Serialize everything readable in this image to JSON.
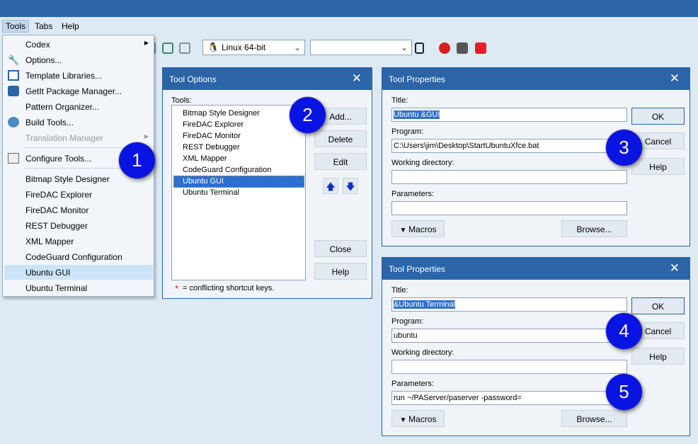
{
  "menubar": {
    "items": [
      "Tools",
      "Tabs",
      "Help"
    ]
  },
  "toolbar": {
    "platform_combo": "Linux 64-bit",
    "config_combo": ""
  },
  "tools_menu": {
    "items": [
      {
        "label": "Codex",
        "icon": "none",
        "submenu": true
      },
      {
        "label": "Options...",
        "icon": "wrench-icon"
      },
      {
        "label": "Template Libraries...",
        "icon": "template-icon"
      },
      {
        "label": "GetIt Package Manager...",
        "icon": "package-icon"
      },
      {
        "label": "Pattern Organizer...",
        "icon": "none"
      },
      {
        "label": "Build Tools...",
        "icon": "build-icon"
      },
      {
        "label": "Translation Manager",
        "icon": "none",
        "disabled": true,
        "submenu": true
      },
      {
        "label": "Configure Tools...",
        "icon": "configure-icon"
      },
      {
        "label": "Bitmap Style Designer"
      },
      {
        "label": "FireDAC Explorer"
      },
      {
        "label": "FireDAC Monitor"
      },
      {
        "label": "REST Debugger"
      },
      {
        "label": "XML Mapper"
      },
      {
        "label": "CodeGuard Configuration"
      },
      {
        "label": "Ubuntu GUI",
        "selected": true
      },
      {
        "label": "Ubuntu Terminal"
      }
    ]
  },
  "tool_options": {
    "title": "Tool Options",
    "tools_label": "Tools:",
    "list": [
      "Bitmap Style Designer",
      "FireDAC Explorer",
      "FireDAC Monitor",
      "REST Debugger",
      "XML Mapper",
      "CodeGuard Configuration",
      "Ubuntu GUI",
      "Ubuntu Terminal"
    ],
    "selected_index": 6,
    "buttons": {
      "add": "Add...",
      "delete": "Delete",
      "edit": "Edit",
      "close": "Close",
      "help": "Help"
    },
    "footnote_star": "*",
    "footnote": "= conflicting shortcut keys."
  },
  "props_top": {
    "title": "Tool Properties",
    "title_label": "Title:",
    "title_value": "Ubuntu &GUI",
    "program_label": "Program:",
    "program_value": "C:\\Users\\jim\\Desktop\\StartUbuntuXfce.bat",
    "workdir_label": "Working directory:",
    "workdir_value": "",
    "params_label": "Parameters:",
    "params_value": "",
    "ok": "OK",
    "cancel": "Cancel",
    "help": "Help",
    "macros": "Macros",
    "browse": "Browse..."
  },
  "props_bottom": {
    "title": "Tool Properties",
    "title_label": "Title:",
    "title_value": "&Ubuntu Terminal",
    "program_label": "Program:",
    "program_value": "ubuntu",
    "workdir_label": "Working directory:",
    "workdir_value": "",
    "params_label": "Parameters:",
    "params_value": "run ~/PAServer/paserver -password=",
    "ok": "OK",
    "cancel": "Cancel",
    "help": "Help",
    "macros": "Macros",
    "browse": "Browse..."
  },
  "badges": [
    "1",
    "2",
    "3",
    "4",
    "5"
  ],
  "colors": {
    "accent": "#2b64a7",
    "badge": "#0a14e2",
    "selection": "#2d6fcf"
  }
}
